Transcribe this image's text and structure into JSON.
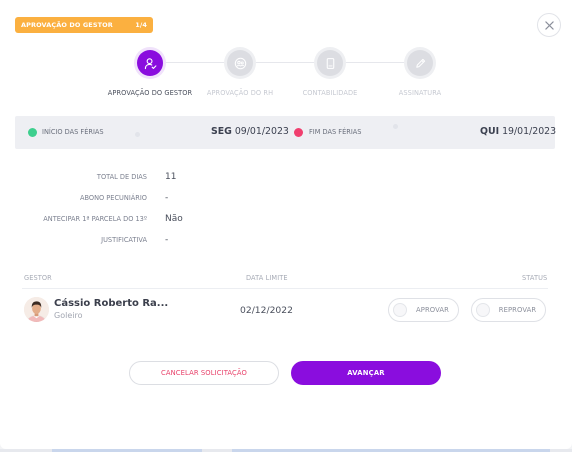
{
  "header": {
    "badge_title": "APROVAÇÃO DO GESTOR",
    "badge_counter": "1/4",
    "close_icon": "close-icon"
  },
  "stepper": {
    "steps": [
      {
        "label": "APROVAÇÃO DO GESTOR",
        "state": "active",
        "icon": "user-check-icon"
      },
      {
        "label": "APROVAÇÃO DO RH",
        "state": "inactive",
        "icon": "people-icon"
      },
      {
        "label": "CONTABILIDADE",
        "state": "inactive",
        "icon": "document-icon"
      },
      {
        "label": "ASSINATURA",
        "state": "inactive",
        "icon": "pen-icon"
      }
    ]
  },
  "vacation": {
    "start_label": "INÍCIO DAS FÉRIAS",
    "start_weekday": "SEG",
    "start_date": "09/01/2023",
    "end_label": "FIM DAS FÉRIAS",
    "end_weekday": "QUI",
    "end_date": "19/01/2023",
    "start_color": "#3ecf8e",
    "end_color": "#f03e6e"
  },
  "details": [
    {
      "label": "TOTAL DE DIAS",
      "value": "11"
    },
    {
      "label": "ABONO PECUNIÁRIO",
      "value": "-"
    },
    {
      "label": "ANTECIPAR 1ª PARCELA DO 13º",
      "value": "Não"
    },
    {
      "label": "JUSTIFICATIVA",
      "value": "-"
    }
  ],
  "table": {
    "headers": {
      "manager": "GESTOR",
      "deadline": "DATA LIMITE",
      "status": "STATUS"
    },
    "row": {
      "name": "Cássio Roberto Ra...",
      "role": "Goleiro",
      "deadline": "02/12/2022",
      "approve_label": "APROVAR",
      "reject_label": "REPROVAR"
    }
  },
  "footer": {
    "cancel_label": "CANCELAR SOLICITAÇÃO",
    "next_label": "AVANÇAR"
  },
  "colors": {
    "accent": "#8a0dde",
    "badge": "#fbb040",
    "cancel_text": "#e8416a"
  }
}
